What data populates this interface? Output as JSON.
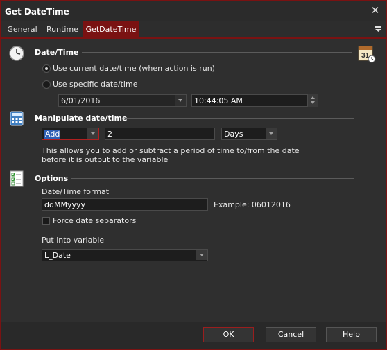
{
  "window": {
    "title": "Get DateTime",
    "close_symbol": "✕"
  },
  "tabs": [
    {
      "label": "General",
      "active": false
    },
    {
      "label": "Runtime",
      "active": false
    },
    {
      "label": "GetDateTime",
      "active": true
    }
  ],
  "date_time_section": {
    "title": "Date/Time",
    "radio_current": {
      "label": "Use current date/time (when action is run)",
      "checked": true
    },
    "radio_specific": {
      "label": "Use specific date/time",
      "checked": false
    },
    "date_value": "6/01/2016",
    "time_value": "10:44:05 AM"
  },
  "manipulate_section": {
    "title": "Manipulate date/time",
    "operation": "Add",
    "amount": "2",
    "unit": "Days",
    "help_line1": "This allows you to add or subtract a period of time to/from the date",
    "help_line2": "before it is output to the variable"
  },
  "options_section": {
    "title": "Options",
    "format_label": "Date/Time format",
    "format_value": "ddMMyyyy",
    "example_text": "Example: 06012016",
    "force_separators_label": "Force date separators",
    "force_separators_checked": false,
    "variable_label": "Put into variable",
    "variable_value": "L_Date"
  },
  "buttons": {
    "ok": "OK",
    "cancel": "Cancel",
    "help": "Help"
  },
  "colors": {
    "accent": "#7a1212",
    "background": "#2d2d2d",
    "input": "#1d1d1d"
  }
}
